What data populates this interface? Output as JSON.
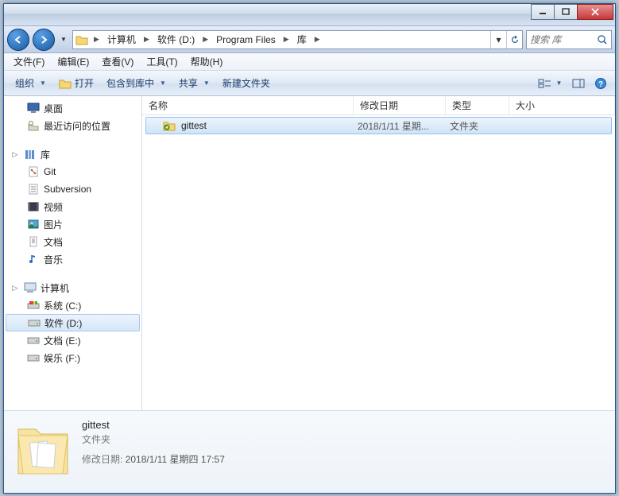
{
  "breadcrumb": {
    "items": [
      "计算机",
      "软件 (D:)",
      "Program Files",
      "库"
    ]
  },
  "search": {
    "placeholder": "搜索 库"
  },
  "menubar": {
    "file": "文件(F)",
    "edit": "编辑(E)",
    "view": "查看(V)",
    "tools": "工具(T)",
    "help": "帮助(H)"
  },
  "toolbar": {
    "organize": "组织",
    "open": "打开",
    "include": "包含到库中",
    "share": "共享",
    "newfolder": "新建文件夹"
  },
  "sidebar": {
    "favorites": {
      "desktop": "桌面",
      "recent": "最近访问的位置"
    },
    "libraries_root": "库",
    "libraries": {
      "git": "Git",
      "subversion": "Subversion",
      "videos": "视频",
      "pictures": "图片",
      "documents": "文档",
      "music": "音乐"
    },
    "computer_root": "计算机",
    "drives": {
      "c": "系统 (C:)",
      "d": "软件 (D:)",
      "e": "文档 (E:)",
      "f": "娱乐 (F:)"
    }
  },
  "columns": {
    "name": "名称",
    "date": "修改日期",
    "type": "类型",
    "size": "大小"
  },
  "rows": [
    {
      "name": "gittest",
      "date": "2018/1/11 星期...",
      "type": "文件夹",
      "size": ""
    }
  ],
  "details": {
    "name": "gittest",
    "type": "文件夹",
    "date_label": "修改日期:",
    "date_value": "2018/1/11 星期四 17:57"
  }
}
